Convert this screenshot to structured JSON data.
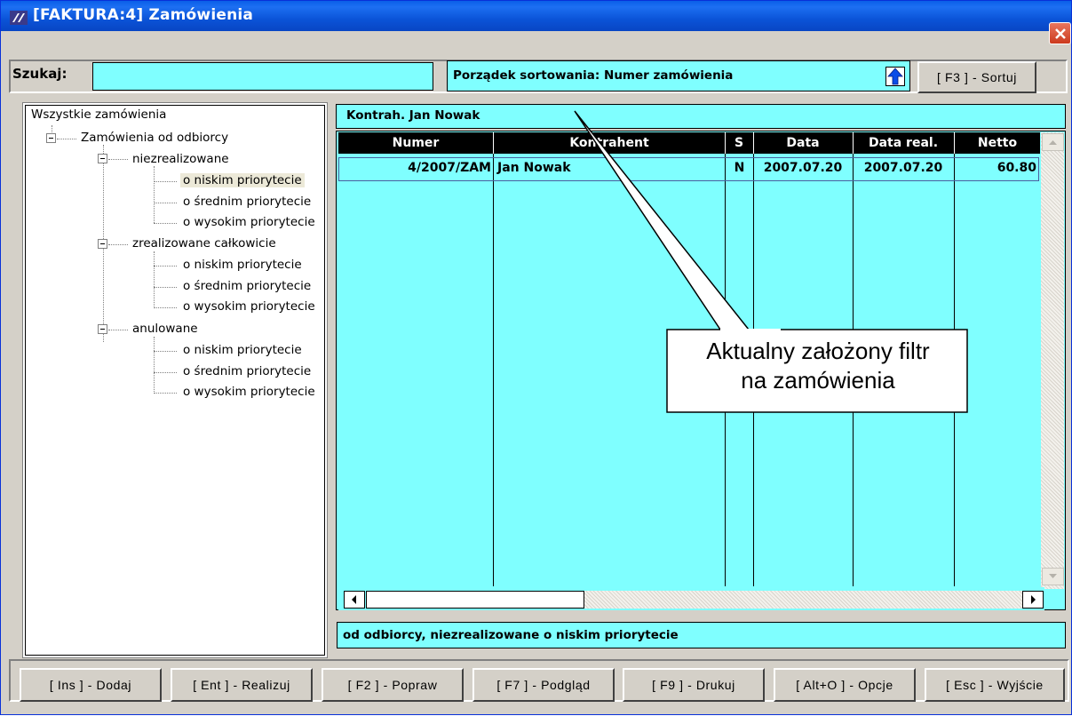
{
  "window": {
    "title": "[FAKTURA:4]  Zamówienia"
  },
  "search": {
    "label": "Szukaj:",
    "value": ""
  },
  "sort": {
    "text": "Porządek sortowania: Numer zamówienia",
    "button": "[ F3 ] - Sortuj",
    "direction": "ascending"
  },
  "tree": {
    "root": "Wszystkie zamówienia",
    "group": "Zamówienia od odbiorcy",
    "sections": [
      {
        "label": "niezrealizowane",
        "items": [
          "o niskim priorytecie",
          "o średnim priorytecie",
          "o wysokim priorytecie"
        ]
      },
      {
        "label": "zrealizowane całkowicie",
        "items": [
          "o niskim priorytecie",
          "o średnim priorytecie",
          "o wysokim priorytecie"
        ]
      },
      {
        "label": "anulowane",
        "items": [
          "o niskim priorytecie",
          "o średnim priorytecie",
          "o wysokim priorytecie"
        ]
      }
    ],
    "selected": "niezrealizowane / o niskim priorytecie"
  },
  "filter": {
    "text": "Kontrah. Jan Nowak"
  },
  "grid": {
    "columns": [
      "Numer",
      "Kontrahent",
      "S",
      "Data",
      "Data real.",
      "Netto"
    ],
    "rows": [
      [
        "4/2007/ZAM",
        "Jan Nowak",
        "N",
        "2007.07.20",
        "2007.07.20",
        "60.80"
      ]
    ]
  },
  "status": {
    "text": "od odbiorcy, niezrealizowane o niskim priorytecie"
  },
  "buttons": [
    "[ Ins ] - Dodaj",
    "[ Ent ] - Realizuj",
    "[ F2 ] - Popraw",
    "[ F7 ] - Podgląd",
    "[ F9 ] - Drukuj",
    "[ Alt+O ] - Opcje",
    "[ Esc ] - Wyjście"
  ],
  "callout": {
    "line1": "Aktualny założony filtr",
    "line2": "na zamówienia"
  },
  "colors": {
    "titlebar": "#0a5fe8",
    "panel": "#7fffff",
    "header": "#000000",
    "window": "#d4d0c8"
  }
}
